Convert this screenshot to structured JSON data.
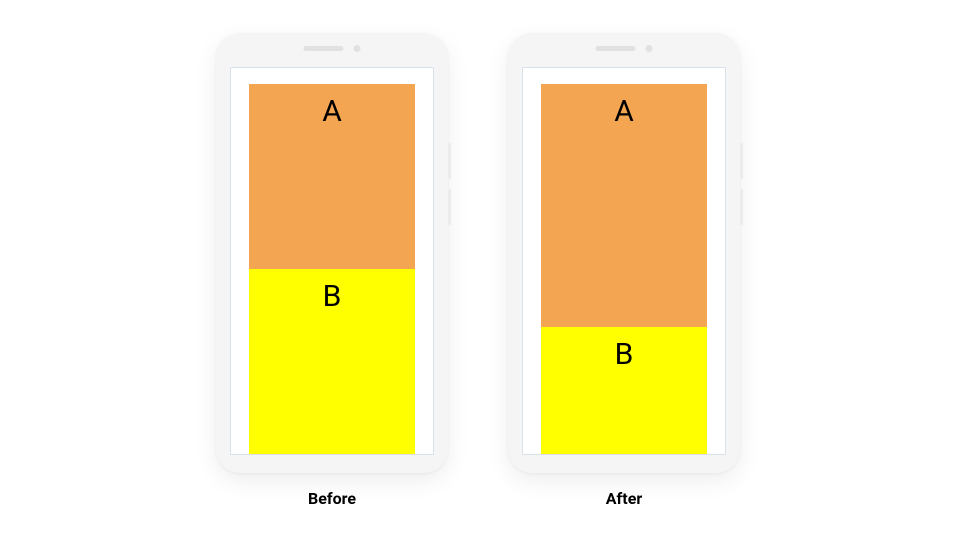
{
  "diagram": {
    "type": "layout-weight-comparison",
    "elements": {
      "block_a_letter": "A",
      "block_b_letter": "B"
    },
    "colors": {
      "block_a": "#f3a552",
      "block_b": "#FFFF00",
      "phone_body": "#f5f5f5",
      "screen_border": "#d9e2ec"
    },
    "phones": [
      {
        "label": "Before",
        "weights": {
          "a": 1,
          "b": 1
        },
        "pixel_ratio_a_pct": 50,
        "pixel_ratio_b_pct": 50
      },
      {
        "label": "After",
        "weights": {
          "a": 2,
          "b": 1
        },
        "pixel_ratio_a_pct": 66.7,
        "pixel_ratio_b_pct": 33.3
      }
    ]
  },
  "captions": {
    "left": "Before",
    "right": "After"
  }
}
